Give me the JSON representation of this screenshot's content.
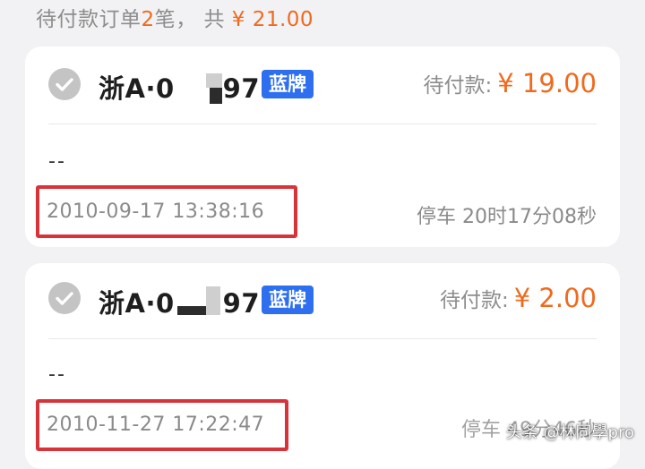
{
  "summary": {
    "prefix": "待付款订单",
    "count": "2",
    "suffix": "笔，",
    "total_label": "共",
    "total": "¥ 21.00"
  },
  "orders": [
    {
      "plate_prefix": "浙A·0",
      "plate_suffix": "97",
      "plate_type": "蓝牌",
      "due_label": "待付款:",
      "due_amount": "¥ 19.00",
      "note": "--",
      "entry_time": "2010-09-17 13:38:16",
      "duration": "停车 20时17分08秒"
    },
    {
      "plate_prefix": "浙A·0",
      "plate_suffix": "97",
      "plate_type": "蓝牌",
      "due_label": "待付款:",
      "due_amount": "¥ 2.00",
      "note": "--",
      "entry_time": "2010-11-27 17:22:47",
      "duration": "停车 49分46秒"
    }
  ],
  "watermark": "头条 @林同學pro",
  "colors": {
    "accent": "#f06a1e",
    "badge": "#2e6ff0",
    "highlight_box": "#d9333a"
  }
}
